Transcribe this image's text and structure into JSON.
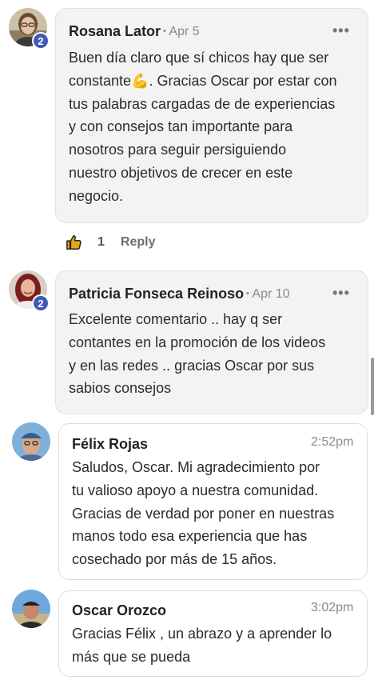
{
  "comments": [
    {
      "author": "Rosana Lator",
      "date": "Apr 5",
      "badge": "2",
      "text_lines": [
        "Buen día claro que sí chicos hay que ser",
        "constante",
        ". Gracias Oscar por estar con",
        "tus palabras cargadas de de experiencias",
        "y con consejos tan importante para",
        "nosotros para seguir persiguiendo",
        "nuestro objetivos de crecer en este",
        "negocio."
      ],
      "emoji": "💪",
      "likes": "1",
      "reply_label": "Reply"
    },
    {
      "author": "Patricia Fonseca Reinoso",
      "date": "Apr 10",
      "badge": "2",
      "text_lines": [
        "Excelente comentario .. hay q ser",
        "contantes en la promoción de los videos",
        "y en las redes .. gracias Oscar por sus",
        "sabios consejos"
      ]
    }
  ],
  "messages": [
    {
      "author": "Félix Rojas",
      "time": "2:52pm",
      "text_lines": [
        "Saludos, Oscar. Mi agradecimiento por",
        "tu valioso apoyo a nuestra comunidad.",
        "Gracias de verdad por poner en nuestras",
        "manos todo esa experiencia que has",
        "cosechado por más de 15 años."
      ]
    },
    {
      "author": "Oscar Orozco",
      "time": "3:02pm",
      "text_lines": [
        "Gracias Félix , un abrazo y a aprender lo",
        "más que se pueda"
      ]
    }
  ],
  "more_glyph": "•••",
  "dot_separator": "•",
  "colors": {
    "badge": "#3f5bb5",
    "card_bg": "#f4f3f1",
    "like_icon": "#e0a817"
  },
  "icons": [
    "thumbs-up-icon",
    "more-icon",
    "muscle-emoji"
  ]
}
